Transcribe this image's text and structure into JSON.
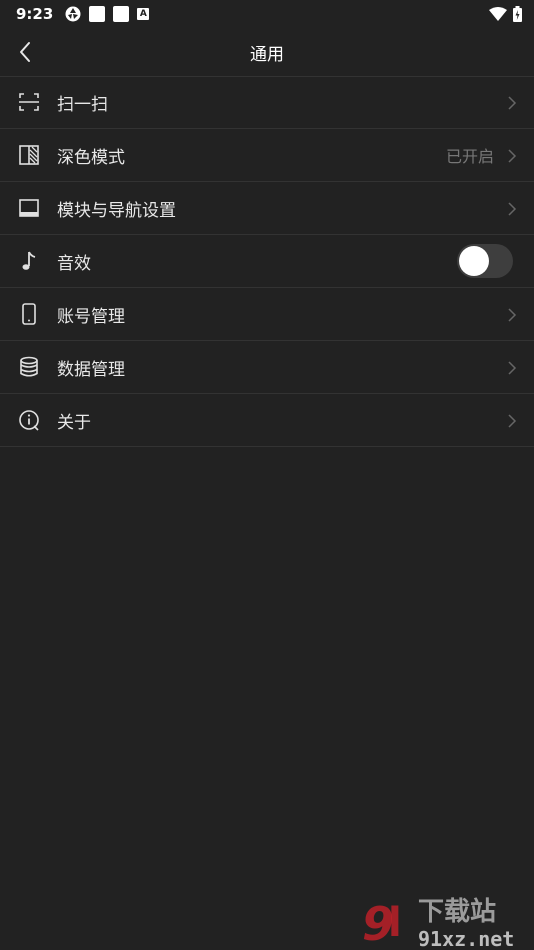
{
  "status_bar": {
    "time": "9:23",
    "notification_letter": "A"
  },
  "header": {
    "title": "通用"
  },
  "settings": [
    {
      "label": "扫一扫",
      "icon": "scan-icon"
    },
    {
      "label": "深色模式",
      "value": "已开启",
      "icon": "dark-mode-icon"
    },
    {
      "label": "模块与导航设置",
      "icon": "navigation-settings-icon"
    },
    {
      "label": "音效",
      "icon": "music-note-icon",
      "toggle": false
    },
    {
      "label": "账号管理",
      "icon": "phone-icon"
    },
    {
      "label": "数据管理",
      "icon": "database-icon"
    },
    {
      "label": "关于",
      "icon": "info-icon"
    }
  ],
  "watermark": {
    "text": "91xz.net",
    "subtext": "下载站"
  },
  "colors": {
    "background": "#222222",
    "divider": "#333333",
    "text": "#e8e8e8",
    "muted": "#777777",
    "watermark_red": "#d0202a"
  }
}
